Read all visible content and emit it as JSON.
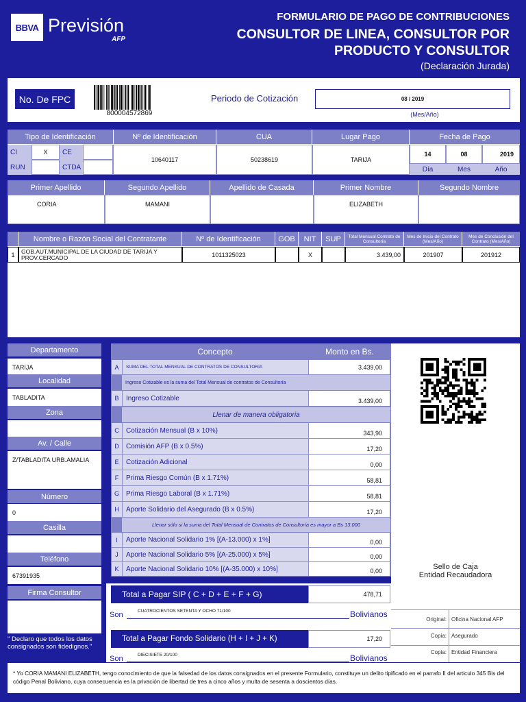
{
  "header": {
    "brand_short": "BBVA",
    "brand_name": "Previsión",
    "brand_sub": "AFP",
    "title_1": "FORMULARIO DE PAGO DE CONTRIBUCIONES",
    "title_2": "CONSULTOR DE LINEA, CONSULTOR POR",
    "title_3": "PRODUCTO Y CONSULTOR",
    "title_4": "(Declaración Jurada)"
  },
  "fpc": {
    "label": "No. De FPC",
    "number": "800004572869",
    "period_label": "Periodo de Cotización",
    "period_value": "08 / 2019",
    "period_hint": "(Mes/Año)"
  },
  "identification": {
    "h_tipo": "Tipo de Identificación",
    "h_num": "Nº de Identificación",
    "h_cua": "CUA",
    "h_lugar": "Lugar Pago",
    "h_fecha": "Fecha de Pago",
    "ci": "CI",
    "ci_mark": "X",
    "ce": "CE",
    "run": "RUN",
    "ctda": "CTDA",
    "num": "10640117",
    "cua": "50238619",
    "lugar": "TARIJA",
    "day": "14",
    "month": "08",
    "year": "2019",
    "day_lbl": "Día",
    "month_lbl": "Mes",
    "year_lbl": "Año"
  },
  "names": {
    "h_ap1": "Primer Apellido",
    "h_ap2": "Segundo Apellido",
    "h_apc": "Apellido de Casada",
    "h_n1": "Primer Nombre",
    "h_n2": "Segundo Nombre",
    "ap1": "CORIA",
    "ap2": "MAMANI",
    "apc": "",
    "n1": "ELIZABETH",
    "n2": ""
  },
  "contract": {
    "h_name": "Nombre o Razón Social del Contratante",
    "h_id": "Nº de Identificación",
    "h_gob": "GOB",
    "h_nit": "NIT",
    "h_sup": "SUP",
    "h_total": "Total Mensual Contrato de Consultoría",
    "h_start": "Mes de Inicio del Contrato (Mes/Año)",
    "h_end": "Mes de Conclusión del Contrato (Mes/Año)",
    "row_num": "1",
    "row_name": "GOB.AUT.MUNICIPAL DE LA CIUDAD DE TARIJA Y PROV.CERCADO",
    "row_id": "1011325023",
    "row_gob": "",
    "row_nit": "X",
    "row_sup": "",
    "row_total": "3.439,00",
    "row_start": "201907",
    "row_end": "201912"
  },
  "address": {
    "h_depto": "Departamento",
    "depto": "TARIJA",
    "h_loc": "Localidad",
    "loc": "TABLADITA",
    "h_zona": "Zona",
    "zona": "",
    "h_calle": "Av. / Calle",
    "calle": "Z/TABLADITA URB.AMALIA",
    "h_numero": "Número",
    "numero": "0",
    "h_casilla": "Casilla",
    "casilla": "",
    "h_tel": "Teléfono",
    "tel": "67391935",
    "h_firma": "Firma Consultor",
    "declaro": "\" Declaro que todos los datos consignados son fidedignos.\""
  },
  "concepts": {
    "h_concepto": "Concepto",
    "h_monto": "Monto en Bs.",
    "a_letter": "A",
    "a_desc": "SUMA DEL TOTAL MENSUAL DE CONTRATOS DE CONSULTORIA",
    "a_val": "3.439,00",
    "note_1": "Ingreso Cotizable es la suma del Total Mensual de contratos de Consultoría",
    "b_letter": "B",
    "b_desc": "Ingreso Cotizable",
    "b_val": "3.439,00",
    "note_2": "Llenar de manera obligatoria",
    "c_letter": "C",
    "c_desc": "Cotización Mensual (B x 10%)",
    "c_val": "343,90",
    "d_letter": "D",
    "d_desc": "Comisión AFP (B x 0.5%)",
    "d_val": "17,20",
    "e_letter": "E",
    "e_desc": "Cotización Adicional",
    "e_val": "0,00",
    "f_letter": "F",
    "f_desc": "Prima Riesgo Común (B x 1.71%)",
    "f_val": "58,81",
    "g_letter": "G",
    "g_desc": "Prima Riesgo Laboral (B x 1.71%)",
    "g_val": "58,81",
    "h_letter": "H",
    "h_desc": "Aporte Solidario del Asegurado (B x 0.5%)",
    "h_val": "17,20",
    "note_3": "Llenar sólo si la suma del Total Mensual de Contratos de Consultoría es mayor a Bs 13.000",
    "i_letter": "I",
    "i_desc": "Aporte Nacional Solidario 1% [(A-13.000) x 1%]",
    "i_val": "0,00",
    "j_letter": "J",
    "j_desc": "Aporte Nacional Solidario 5% [(A-25.000) x 5%]",
    "j_val": "0,00",
    "k_letter": "K",
    "k_desc": "Aporte Nacional Solidario 10% [(A-35.000) x 10%]",
    "k_val": "0,00"
  },
  "totals": {
    "sip_label": "Total a Pagar SIP ( C + D + E + F + G)",
    "sip_val": "478,71",
    "son": "Son",
    "sip_words": "CUATROCIENTOS SETENTA Y OCHO 71/100",
    "bolivianos": "Bolivianos",
    "fs_label": "Total a Pagar Fondo Solidario (H + I + J + K)",
    "fs_val": "17,20",
    "fs_words": "DIECISIETE 20/100"
  },
  "stamp": {
    "sello_1": "Sello de Caja",
    "sello_2": "Entidad Recaudadora",
    "c1_label": "Original:",
    "c1_value": "Oficina Nacional AFP",
    "c2_label": "Copia:",
    "c2_value": "Asegurado",
    "c3_label": "Copia:",
    "c3_value": "Entidad Financiera"
  },
  "footer": {
    "legal": "* Yo CORIA MAMANI ELIZABETH, tengo conocimiento de que la falsedad de los datos consignados en el presente Formulario, constituye un delito tipificado en el parrafo II del articulo 345 Bis del código Penal Boliviano, cuya consecuencia es la privación de libertad de tres a cinco años y multa de sesenta a doscientos días."
  },
  "colors": {
    "navy": "#1d1e9c",
    "header_cell": "#7d80c7",
    "light_cell": "#c4c5e6"
  },
  "icons": [
    "barcode-icon",
    "qr-code-icon"
  ]
}
